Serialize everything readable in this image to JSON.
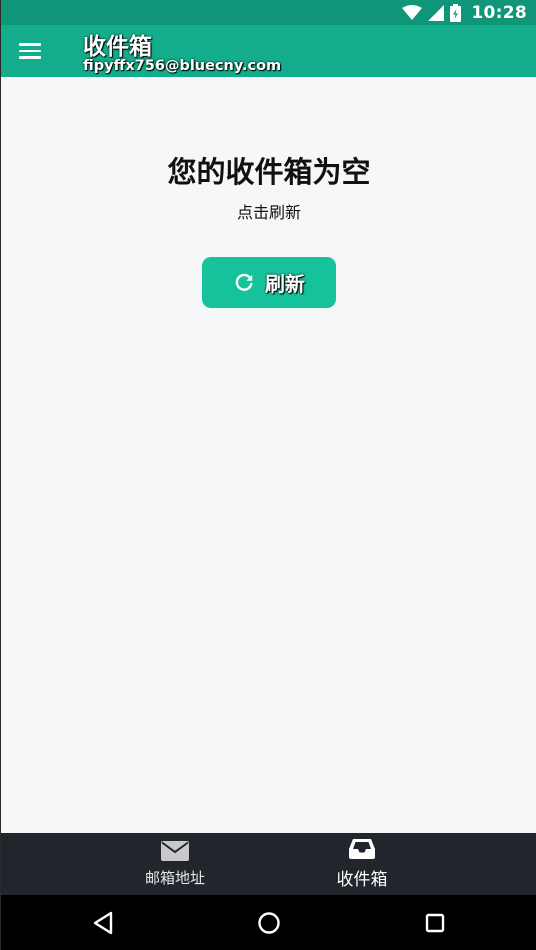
{
  "status_bar": {
    "time": "10:28",
    "icons": [
      "wifi-icon",
      "signal-icon",
      "battery-icon"
    ]
  },
  "app_bar": {
    "title": "收件箱",
    "subtitle": "fipyffx756@bluecny.com",
    "menu_icon": "menu-icon"
  },
  "main": {
    "empty_title": "您的收件箱为空",
    "empty_hint": "点击刷新",
    "refresh_button": {
      "label": "刷新",
      "icon": "refresh-icon"
    }
  },
  "tabs": [
    {
      "label": "邮箱地址",
      "icon": "mail-icon",
      "active": false
    },
    {
      "label": "收件箱",
      "icon": "inbox-icon",
      "active": true
    }
  ],
  "nav_bar": {
    "buttons": [
      "back-icon",
      "home-icon",
      "recents-icon"
    ]
  },
  "colors": {
    "status_bar": "#0f9577",
    "app_bar": "#13ad8c",
    "accent_button": "#16c29b",
    "background": "#f5f7f9",
    "tab_bar": "#22252b",
    "nav_bar": "#000000"
  }
}
